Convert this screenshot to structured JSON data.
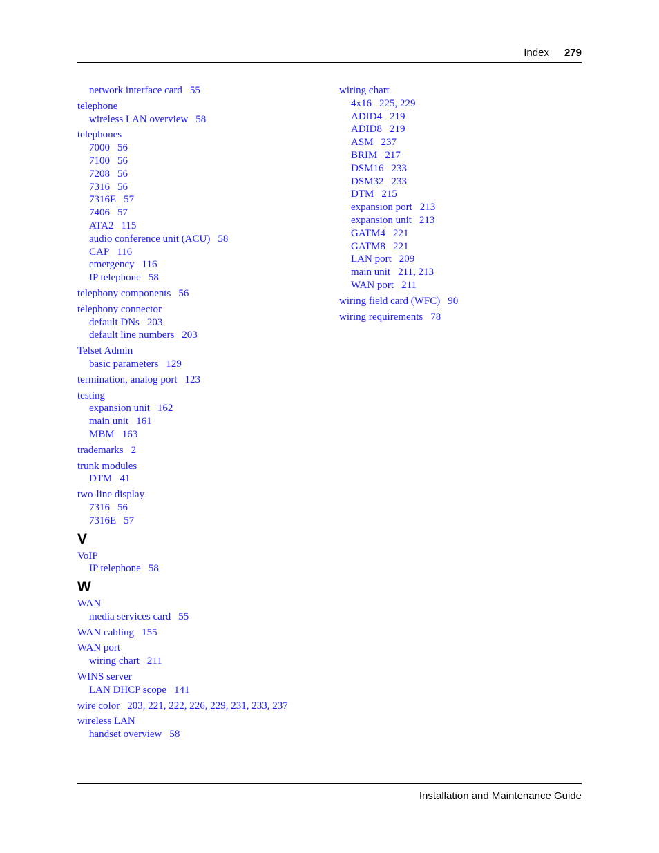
{
  "header": {
    "section": "Index",
    "page_number": "279"
  },
  "footer": {
    "title": "Installation and Maintenance Guide"
  },
  "left_column": [
    {
      "type": "entry",
      "term": null,
      "pages": null,
      "subs": [
        {
          "term": "network interface card",
          "pages": "55"
        }
      ]
    },
    {
      "type": "entry",
      "term": "telephone",
      "pages": null,
      "subs": [
        {
          "term": "wireless LAN overview",
          "pages": "58"
        }
      ]
    },
    {
      "type": "entry",
      "term": "telephones",
      "pages": null,
      "subs": [
        {
          "term": "7000",
          "pages": "56"
        },
        {
          "term": "7100",
          "pages": "56"
        },
        {
          "term": "7208",
          "pages": "56"
        },
        {
          "term": "7316",
          "pages": "56"
        },
        {
          "term": "7316E",
          "pages": "57"
        },
        {
          "term": "7406",
          "pages": "57"
        },
        {
          "term": "ATA2",
          "pages": "115"
        },
        {
          "term": "audio conference unit (ACU)",
          "pages": "58"
        },
        {
          "term": "CAP",
          "pages": "116"
        },
        {
          "term": "emergency",
          "pages": "116"
        },
        {
          "term": "IP telephone",
          "pages": "58"
        }
      ]
    },
    {
      "type": "entry",
      "term": "telephony components",
      "pages": "56",
      "subs": []
    },
    {
      "type": "entry",
      "term": "telephony connector",
      "pages": null,
      "subs": [
        {
          "term": "default DNs",
          "pages": "203"
        },
        {
          "term": "default line numbers",
          "pages": "203"
        }
      ]
    },
    {
      "type": "entry",
      "term": "Telset Admin",
      "pages": null,
      "subs": [
        {
          "term": "basic parameters",
          "pages": "129"
        }
      ]
    },
    {
      "type": "entry",
      "term": "termination, analog port",
      "pages": "123",
      "subs": []
    },
    {
      "type": "entry",
      "term": "testing",
      "pages": null,
      "subs": [
        {
          "term": "expansion unit",
          "pages": "162"
        },
        {
          "term": "main unit",
          "pages": "161"
        },
        {
          "term": "MBM",
          "pages": "163"
        }
      ]
    },
    {
      "type": "entry",
      "term": "trademarks",
      "pages": "2",
      "subs": []
    },
    {
      "type": "entry",
      "term": "trunk modules",
      "pages": null,
      "subs": [
        {
          "term": "DTM",
          "pages": "41"
        }
      ]
    },
    {
      "type": "entry",
      "term": "two-line display",
      "pages": null,
      "subs": [
        {
          "term": "7316",
          "pages": "56"
        },
        {
          "term": "7316E",
          "pages": "57"
        }
      ]
    },
    {
      "type": "letter",
      "label": "V"
    },
    {
      "type": "entry",
      "term": "VoIP",
      "pages": null,
      "subs": [
        {
          "term": "IP telephone",
          "pages": "58"
        }
      ]
    },
    {
      "type": "letter",
      "label": "W"
    },
    {
      "type": "entry",
      "term": "WAN",
      "pages": null,
      "subs": [
        {
          "term": "media services card",
          "pages": "55"
        }
      ]
    },
    {
      "type": "entry",
      "term": "WAN cabling",
      "pages": "155",
      "subs": []
    },
    {
      "type": "entry",
      "term": "WAN port",
      "pages": null,
      "subs": [
        {
          "term": "wiring chart",
          "pages": "211"
        }
      ]
    },
    {
      "type": "entry",
      "term": "WINS server",
      "pages": null,
      "subs": [
        {
          "term": "LAN DHCP scope",
          "pages": "141"
        }
      ]
    },
    {
      "type": "entry",
      "term": "wire color",
      "pages": "203, 221, 222, 226, 229, 231, 233, 237",
      "subs": []
    },
    {
      "type": "entry",
      "term": "wireless LAN",
      "pages": null,
      "subs": [
        {
          "term": "handset overview",
          "pages": "58"
        }
      ]
    }
  ],
  "right_column": [
    {
      "type": "entry",
      "term": "wiring chart",
      "pages": null,
      "subs": [
        {
          "term": "4x16",
          "pages": "225, 229"
        },
        {
          "term": "ADID4",
          "pages": "219"
        },
        {
          "term": "ADID8",
          "pages": "219"
        },
        {
          "term": "ASM",
          "pages": "237"
        },
        {
          "term": "BRIM",
          "pages": "217"
        },
        {
          "term": "DSM16",
          "pages": "233"
        },
        {
          "term": "DSM32",
          "pages": "233"
        },
        {
          "term": "DTM",
          "pages": "215"
        },
        {
          "term": "expansion port",
          "pages": "213"
        },
        {
          "term": "expansion unit",
          "pages": "213"
        },
        {
          "term": "GATM4",
          "pages": "221"
        },
        {
          "term": "GATM8",
          "pages": "221"
        },
        {
          "term": "LAN port",
          "pages": "209"
        },
        {
          "term": "main unit",
          "pages": "211, 213"
        },
        {
          "term": "WAN port",
          "pages": "211"
        }
      ]
    },
    {
      "type": "entry",
      "term": "wiring field card (WFC)",
      "pages": "90",
      "subs": []
    },
    {
      "type": "entry",
      "term": "wiring requirements",
      "pages": "78",
      "subs": []
    }
  ],
  "colors": {
    "link": "#1a1aff",
    "text": "#000000",
    "background": "#ffffff"
  }
}
